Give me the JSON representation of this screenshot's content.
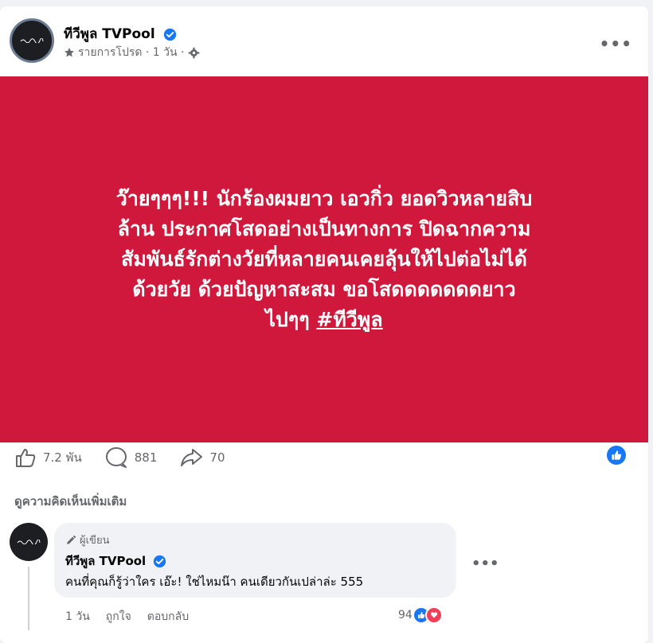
{
  "post": {
    "page_name": "ทีวีพูล TVPool",
    "subline": "รายการโปรด · 1 วัน ·",
    "more_label": "•••",
    "banner_lines": [
      "ว๊ายๆๆๆ!!! นักร้องผมยาว เอวกิ่ว ยอดวิวหลายสิบ",
      "ล้าน ประกาศโสดอย่างเป็นทางการ ปิดฉากความ",
      "สัมพันธ์รักต่างวัยที่หลายคนเคยลุ้นให้ไปต่อไม่ได้",
      "ด้วยวัย ด้วยปัญหาสะสม ขอโสดดดดดดดยาว"
    ],
    "banner_last_prefix": "ไปๆๆ ",
    "banner_hashtag": "#ทีวีพูล",
    "banner_color": "#d0183c"
  },
  "stats": {
    "likes": "7.2 พัน",
    "comments": "881",
    "shares": "70"
  },
  "comments_section": {
    "more_label": "ดูความคิดเห็นเพิ่มเติม",
    "comment": {
      "author_badge": "ผู้เขียน",
      "name": "ทีวีพูล TVPool",
      "text": "คนที่คุณก็รู้ว่าใคร เอ๊ะ! ใช่ไหมน๊า คนเดียวกันเปล่าล่ะ 555",
      "more_label": "•••",
      "time": "1 วัน",
      "like_action": "ถูกใจ",
      "reply_action": "ตอบกลับ",
      "reaction_count": "94"
    }
  },
  "icons": [
    "star-icon",
    "gear-icon",
    "verified-icon",
    "like-icon",
    "comment-icon",
    "share-icon",
    "pencil-icon"
  ],
  "colors": {
    "accent": "#1877f2",
    "banner": "#d0183c",
    "love": "#f33e58"
  }
}
